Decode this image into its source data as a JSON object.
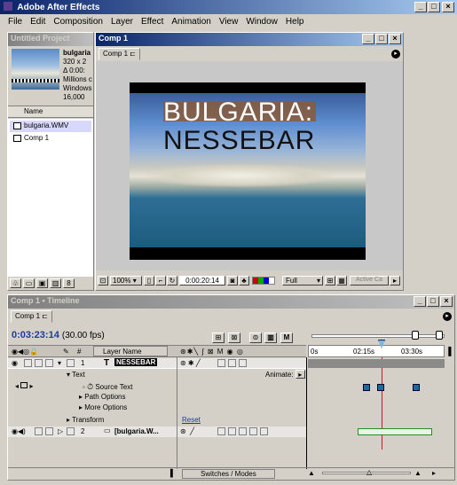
{
  "app": {
    "title": "Adobe After Effects"
  },
  "menu": [
    "File",
    "Edit",
    "Composition",
    "Layer",
    "Effect",
    "Animation",
    "View",
    "Window",
    "Help"
  ],
  "project": {
    "title": "Untitled Project",
    "file_name": "bulgaria",
    "info": [
      "320 x 2",
      "Δ 0:00:",
      "Millions c",
      "Windows",
      "16,000"
    ],
    "column_name": "Name",
    "items": [
      "bulgaria.WMV",
      "Comp 1"
    ]
  },
  "comp": {
    "title": "Comp 1",
    "tab": "Comp 1",
    "text_line1": "BULGARIA:",
    "text_line2": "NESSEBAR",
    "zoom": "100%",
    "timecode": "0:00:20:14",
    "resolution": "Full",
    "active_camera": "Active Ca"
  },
  "timeline": {
    "title": "Comp 1 • Timeline",
    "tab": "Comp 1",
    "timecode": "0:03:23:14",
    "fps": "(30.00 fps)",
    "layer_name_header": "Layer Name",
    "animate_label": "Animate:",
    "ruler": [
      "0s",
      "02:15s",
      "03:30s"
    ],
    "layers": [
      {
        "num": "1",
        "name": "NESSEBAR"
      },
      {
        "num": "2",
        "name": "[bulgaria.W..."
      }
    ],
    "props": [
      "Text",
      "Source Text",
      "Path Options",
      "More Options",
      "Transform"
    ],
    "reset_label": "Reset",
    "switches_label": "Switches / Modes"
  },
  "colors": {
    "titlebar": "#0a246a",
    "panel": "#d4d0c8",
    "layer_bar": "#1a1a1a"
  }
}
